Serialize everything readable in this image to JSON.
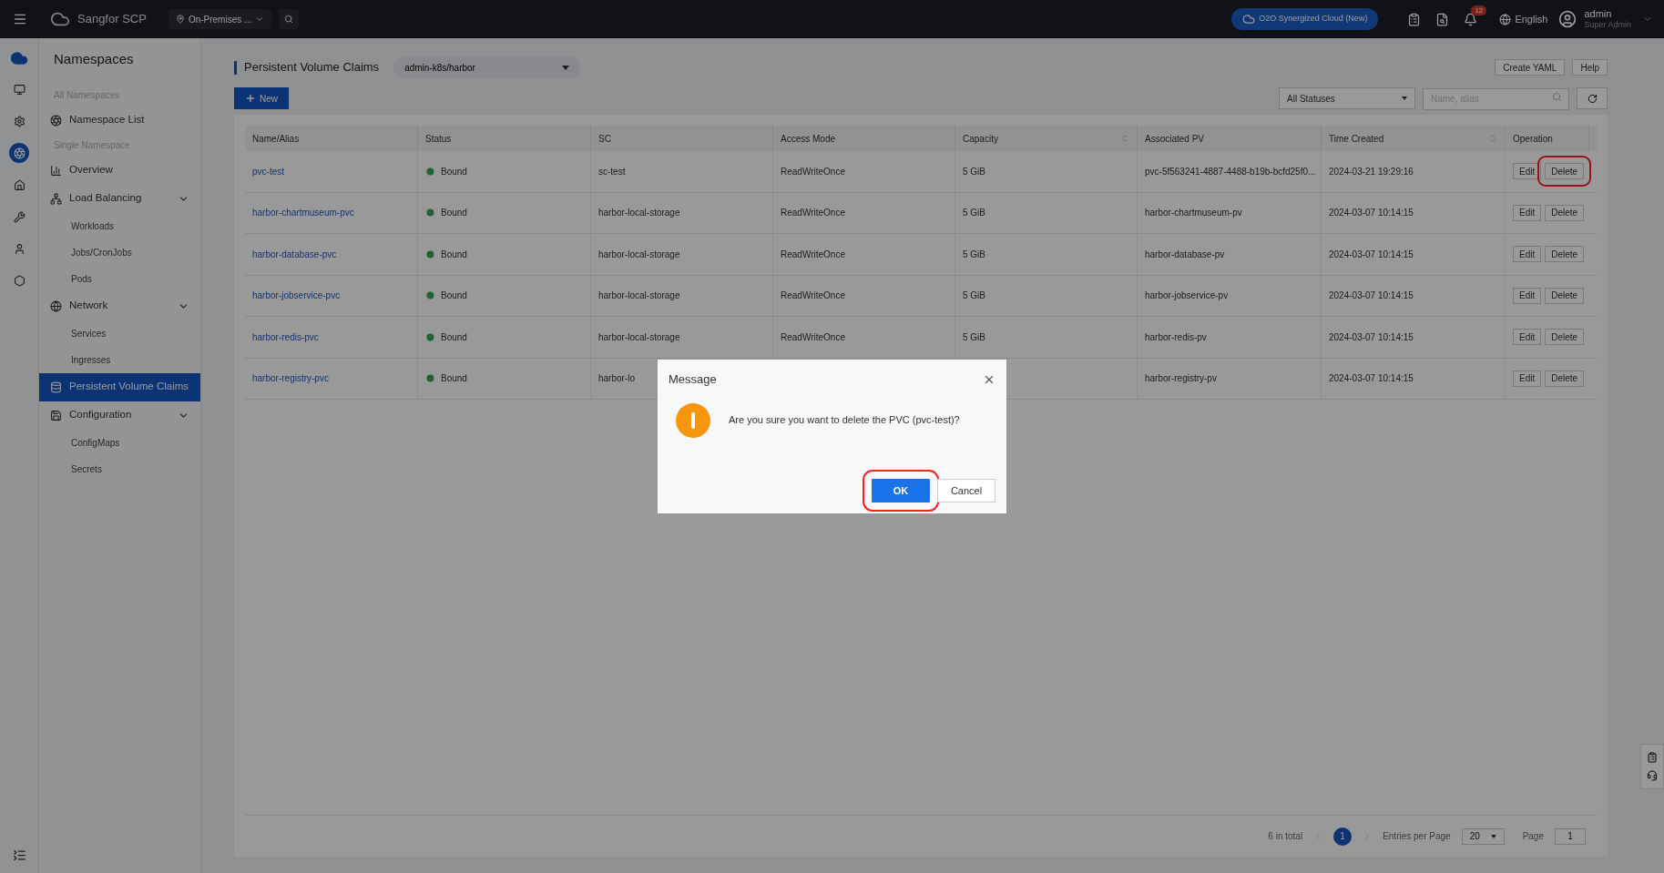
{
  "topbar": {
    "brand": "Sangfor SCP",
    "location": "On-Premises ...",
    "cloud_button": "O2O Synergized Cloud (New)",
    "notification_count": "12",
    "language": "English",
    "user": {
      "name": "admin",
      "role": "Super Admin"
    }
  },
  "rail": [
    {
      "selected": false
    },
    {
      "selected": false
    },
    {
      "selected": true
    },
    {
      "selected": false
    },
    {
      "selected": false
    },
    {
      "selected": false
    },
    {
      "selected": false
    }
  ],
  "sidebar": {
    "title": "Namespaces",
    "items": [
      {
        "kind": "section",
        "label": "All Namespaces"
      },
      {
        "kind": "item",
        "label": "Namespace List",
        "selected": false
      },
      {
        "kind": "section",
        "label": "Single Namespace"
      },
      {
        "kind": "item",
        "label": "Overview",
        "selected": false
      },
      {
        "kind": "group",
        "label": "Load Balancing",
        "expanded": true,
        "children": [
          {
            "label": "Workloads",
            "selected": false
          },
          {
            "label": "Jobs/CronJobs",
            "selected": false
          },
          {
            "label": "Pods",
            "selected": false
          }
        ]
      },
      {
        "kind": "group",
        "label": "Network",
        "expanded": true,
        "children": [
          {
            "label": "Services",
            "selected": false
          },
          {
            "label": "Ingresses",
            "selected": false
          }
        ]
      },
      {
        "kind": "item",
        "label": "Persistent Volume Claims",
        "selected": true
      },
      {
        "kind": "group",
        "label": "Configuration",
        "expanded": true,
        "children": [
          {
            "label": "ConfigMaps",
            "selected": false
          },
          {
            "label": "Secrets",
            "selected": false
          }
        ]
      }
    ]
  },
  "page": {
    "title": "Persistent Volume Claims",
    "namespace_select": "admin-k8s/harbor",
    "header_buttons": [
      "Create YAML",
      "Help"
    ],
    "new_button": "New",
    "status_filter": "All Statuses",
    "search": {
      "placeholder": "Name, alias"
    }
  },
  "table": {
    "columns": [
      {
        "label": "Name/Alias",
        "sortable": false
      },
      {
        "label": "Status",
        "sortable": false
      },
      {
        "label": "SC",
        "sortable": false
      },
      {
        "label": "Access Mode",
        "sortable": false
      },
      {
        "label": "Capacity",
        "sortable": true
      },
      {
        "label": "Associated PV",
        "sortable": false
      },
      {
        "label": "Time Created",
        "sortable": true
      },
      {
        "label": "Operation",
        "sortable": false
      }
    ],
    "rows": [
      {
        "name": "pvc-test",
        "status": "Bound",
        "sc": "sc-test",
        "access_mode": "ReadWriteOnce",
        "capacity": "5 GiB",
        "pv": "pvc-5f563241-4887-4488-b19b-bcfd25f0...",
        "created": "2024-03-21 19:29:16",
        "operations": [
          {
            "label": "Edit",
            "highlighted": false
          },
          {
            "label": "Delete",
            "highlighted": true
          }
        ]
      },
      {
        "name": "harbor-chartmuseum-pvc",
        "status": "Bound",
        "sc": "harbor-local-storage",
        "access_mode": "ReadWriteOnce",
        "capacity": "5 GiB",
        "pv": "harbor-chartmuseum-pv",
        "created": "2024-03-07 10:14:15",
        "operations": [
          {
            "label": "Edit",
            "highlighted": false
          },
          {
            "label": "Delete",
            "highlighted": false
          }
        ]
      },
      {
        "name": "harbor-database-pvc",
        "status": "Bound",
        "sc": "harbor-local-storage",
        "access_mode": "ReadWriteOnce",
        "capacity": "5 GiB",
        "pv": "harbor-database-pv",
        "created": "2024-03-07 10:14:15",
        "operations": [
          {
            "label": "Edit",
            "highlighted": false
          },
          {
            "label": "Delete",
            "highlighted": false
          }
        ]
      },
      {
        "name": "harbor-jobservice-pvc",
        "status": "Bound",
        "sc": "harbor-local-storage",
        "access_mode": "ReadWriteOnce",
        "capacity": "5 GiB",
        "pv": "harbor-jobservice-pv",
        "created": "2024-03-07 10:14:15",
        "operations": [
          {
            "label": "Edit",
            "highlighted": false
          },
          {
            "label": "Delete",
            "highlighted": false
          }
        ]
      },
      {
        "name": "harbor-redis-pvc",
        "status": "Bound",
        "sc": "harbor-local-storage",
        "access_mode": "ReadWriteOnce",
        "capacity": "5 GiB",
        "pv": "harbor-redis-pv",
        "created": "2024-03-07 10:14:15",
        "operations": [
          {
            "label": "Edit",
            "highlighted": false
          },
          {
            "label": "Delete",
            "highlighted": false
          }
        ]
      },
      {
        "name": "harbor-registry-pvc",
        "status": "Bound",
        "sc": "harbor-lo",
        "pv": "harbor-registry-pv",
        "created": "2024-03-07 10:14:15",
        "operations": [
          {
            "label": "Edit",
            "highlighted": false
          },
          {
            "label": "Delete",
            "highlighted": false
          }
        ]
      }
    ]
  },
  "pagination": {
    "total": "6 in total",
    "pages": [
      {
        "label": "1",
        "selected": true
      }
    ],
    "per_page_label": "Entries per Page",
    "per_page": "20",
    "page_label": "Page",
    "page_value": "1"
  },
  "dialog": {
    "title": "Message",
    "message": "Are you sure you want to delete the PVC (pvc-test)?",
    "buttons": [
      {
        "label": "OK",
        "kind": "primary",
        "highlighted": true
      },
      {
        "label": "Cancel",
        "kind": "default",
        "highlighted": false
      }
    ]
  }
}
